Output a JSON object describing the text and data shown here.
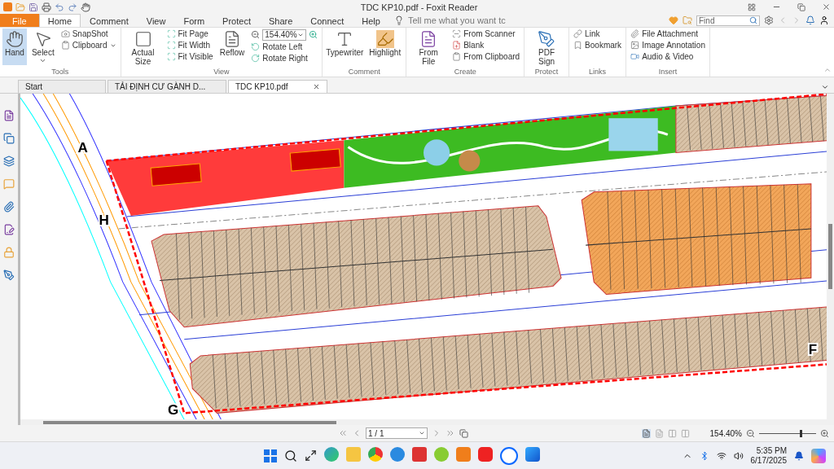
{
  "window": {
    "title": "TDC KP10.pdf - Foxit Reader"
  },
  "ribbon_tabs": [
    {
      "label": "File",
      "kind": "file",
      "selected": false
    },
    {
      "label": "Home",
      "kind": "tab",
      "selected": true
    },
    {
      "label": "Comment",
      "kind": "tab",
      "selected": false
    },
    {
      "label": "View",
      "kind": "tab",
      "selected": false
    },
    {
      "label": "Form",
      "kind": "tab",
      "selected": false
    },
    {
      "label": "Protect",
      "kind": "tab",
      "selected": false
    },
    {
      "label": "Share",
      "kind": "tab",
      "selected": false
    },
    {
      "label": "Connect",
      "kind": "tab",
      "selected": false
    },
    {
      "label": "Help",
      "kind": "tab",
      "selected": false
    }
  ],
  "tell_me": {
    "placeholder": "Tell me what you want tc"
  },
  "find": {
    "placeholder": "Find"
  },
  "groups": [
    {
      "label": "Tools",
      "items": [
        {
          "label": "Hand",
          "kind": "large",
          "selected": true
        },
        {
          "label": "Select",
          "kind": "large-menu",
          "selected": false
        },
        {
          "label": "SnapShot",
          "kind": "small",
          "selected": false
        },
        {
          "label": "Clipboard",
          "kind": "small-menu",
          "selected": false
        }
      ]
    },
    {
      "label": "View",
      "items": [
        {
          "label": "Actual Size",
          "kind": "large",
          "selected": false
        },
        {
          "label": "Fit Page",
          "kind": "small",
          "selected": false
        },
        {
          "label": "Fit Width",
          "kind": "small",
          "selected": false
        },
        {
          "label": "Fit Visible",
          "kind": "small",
          "selected": false
        },
        {
          "label": "Reflow",
          "kind": "large",
          "selected": false
        },
        {
          "label": "154.40%",
          "kind": "zoom"
        },
        {
          "label": "Rotate Left",
          "kind": "small",
          "selected": false
        },
        {
          "label": "Rotate Right",
          "kind": "small",
          "selected": false
        }
      ]
    },
    {
      "label": "Comment",
      "items": [
        {
          "label": "Typewriter",
          "kind": "large",
          "selected": false
        },
        {
          "label": "Highlight",
          "kind": "large",
          "selected": false
        }
      ]
    },
    {
      "label": "Create",
      "items": [
        {
          "label": "From File",
          "kind": "large",
          "selected": false
        },
        {
          "label": "From Scanner",
          "kind": "small",
          "selected": false
        },
        {
          "label": "Blank",
          "kind": "small",
          "selected": false
        },
        {
          "label": "From Clipboard",
          "kind": "small",
          "selected": false
        }
      ]
    },
    {
      "label": "Protect",
      "items": [
        {
          "label": "PDF Sign",
          "kind": "large",
          "selected": false
        }
      ]
    },
    {
      "label": "Links",
      "items": [
        {
          "label": "Link",
          "kind": "small",
          "selected": false
        },
        {
          "label": "Bookmark",
          "kind": "small",
          "selected": false
        }
      ]
    },
    {
      "label": "Insert",
      "items": [
        {
          "label": "File Attachment",
          "kind": "small",
          "selected": false
        },
        {
          "label": "Image Annotation",
          "kind": "small",
          "selected": false
        },
        {
          "label": "Audio & Video",
          "kind": "small",
          "selected": false
        }
      ]
    }
  ],
  "doc_tabs": [
    {
      "label": "Start",
      "selected": false
    },
    {
      "label": "TẢI ĐỊNH CƯ GÀNH D...",
      "selected": false
    },
    {
      "label": "TDC KP10.pdf",
      "selected": true
    }
  ],
  "plan": {
    "corner_labels": [
      "A",
      "H",
      "G",
      "F"
    ]
  },
  "status_bar": {
    "page": "1 / 1",
    "zoom": "154.40%",
    "level": 0.72
  },
  "taskbar": {
    "time": "5:35 PM",
    "date": "6/17/2025"
  }
}
